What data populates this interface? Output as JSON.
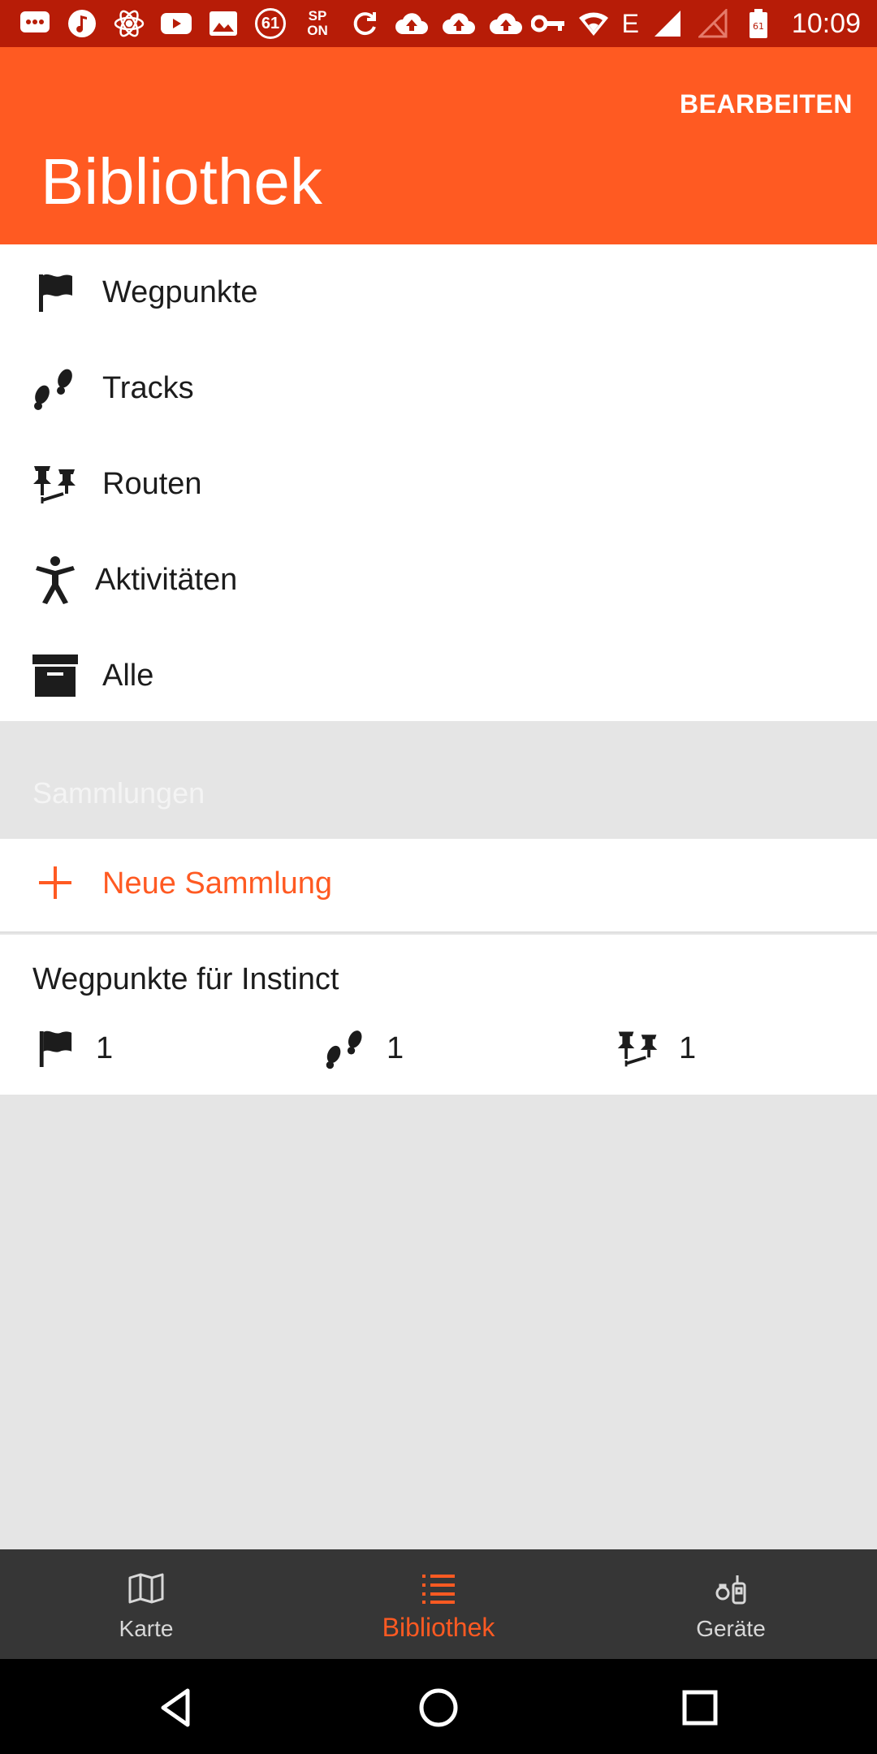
{
  "status_bar": {
    "badge_61": "61",
    "sp_line1": "SP",
    "sp_line2": "ON",
    "network_type": "E",
    "time": "10:09"
  },
  "app_bar": {
    "edit_label": "BEARBEITEN",
    "title": "Bibliothek"
  },
  "menu": {
    "items": [
      {
        "label": "Wegpunkte",
        "icon": "flag-icon"
      },
      {
        "label": "Tracks",
        "icon": "footprints-icon"
      },
      {
        "label": "Routen",
        "icon": "route-pins-icon"
      },
      {
        "label": "Aktivitäten",
        "icon": "person-icon"
      },
      {
        "label": "Alle",
        "icon": "archive-box-icon"
      }
    ]
  },
  "collections": {
    "header": "Sammlungen",
    "new_label": "Neue Sammlung",
    "items": [
      {
        "name": "Wegpunkte für Instinct",
        "waypoints": "1",
        "tracks": "1",
        "routes": "1"
      }
    ]
  },
  "bottom_nav": {
    "items": [
      {
        "label": "Karte",
        "icon": "map-icon",
        "active": false
      },
      {
        "label": "Bibliothek",
        "icon": "list-icon",
        "active": true
      },
      {
        "label": "Geräte",
        "icon": "devices-icon",
        "active": false
      }
    ]
  },
  "colors": {
    "accent": "#ff5a22",
    "status_bar": "#b71c07",
    "bottom_nav": "#363636",
    "background": "#e5e5e5"
  }
}
